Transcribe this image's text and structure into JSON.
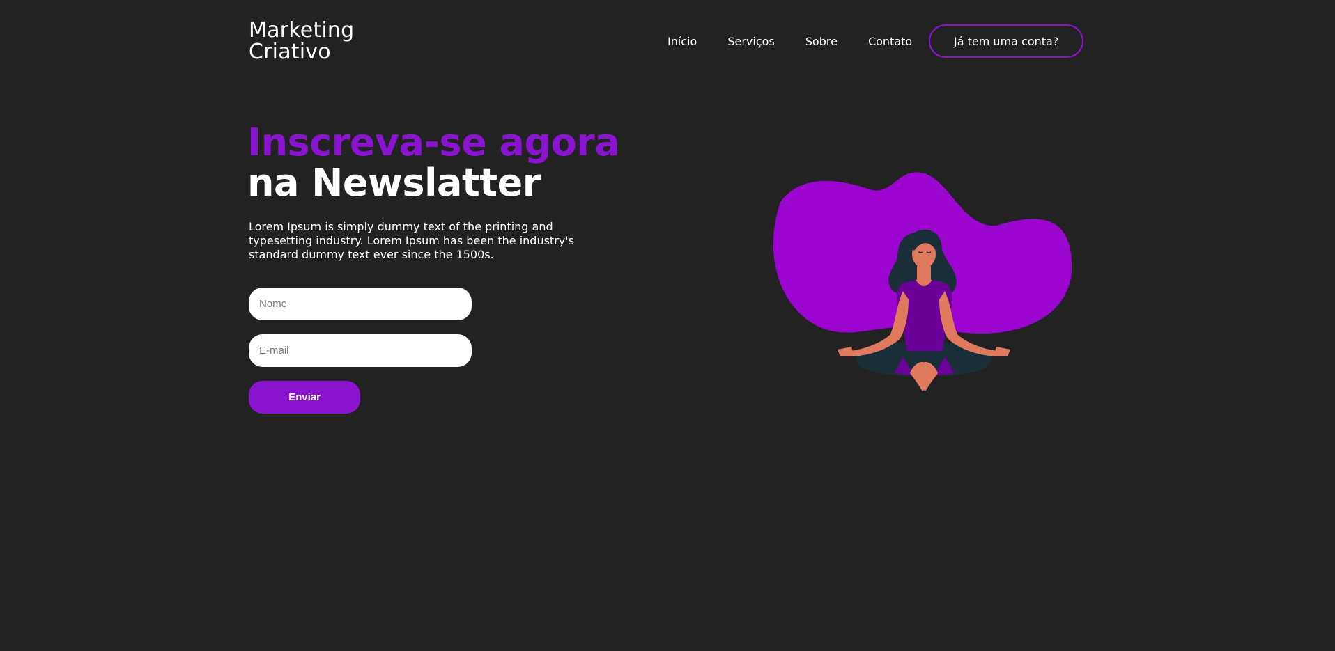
{
  "brand": {
    "line1": "Marketing",
    "line2": "Criativo"
  },
  "nav": {
    "items": [
      "Início",
      "Serviços",
      "Sobre",
      "Contato"
    ],
    "account_label": "Já tem uma conta?"
  },
  "hero": {
    "title_highlight": "Inscreva-se agora",
    "title_rest": "na Newslatter",
    "description": "Lorem Ipsum is simply dummy text of the printing and typesetting industry. Lorem Ipsum has been the industry's standard dummy text ever since the 1500s."
  },
  "form": {
    "name_placeholder": "Nome",
    "name_value": "",
    "email_placeholder": "E-mail",
    "email_value": "",
    "submit_label": "Enviar"
  },
  "illustration": {
    "icon": "meditating-woman-icon",
    "blob_color": "#9b05cf"
  },
  "colors": {
    "background": "#222222",
    "accent": "#8a13cf",
    "text": "#ffffff"
  }
}
